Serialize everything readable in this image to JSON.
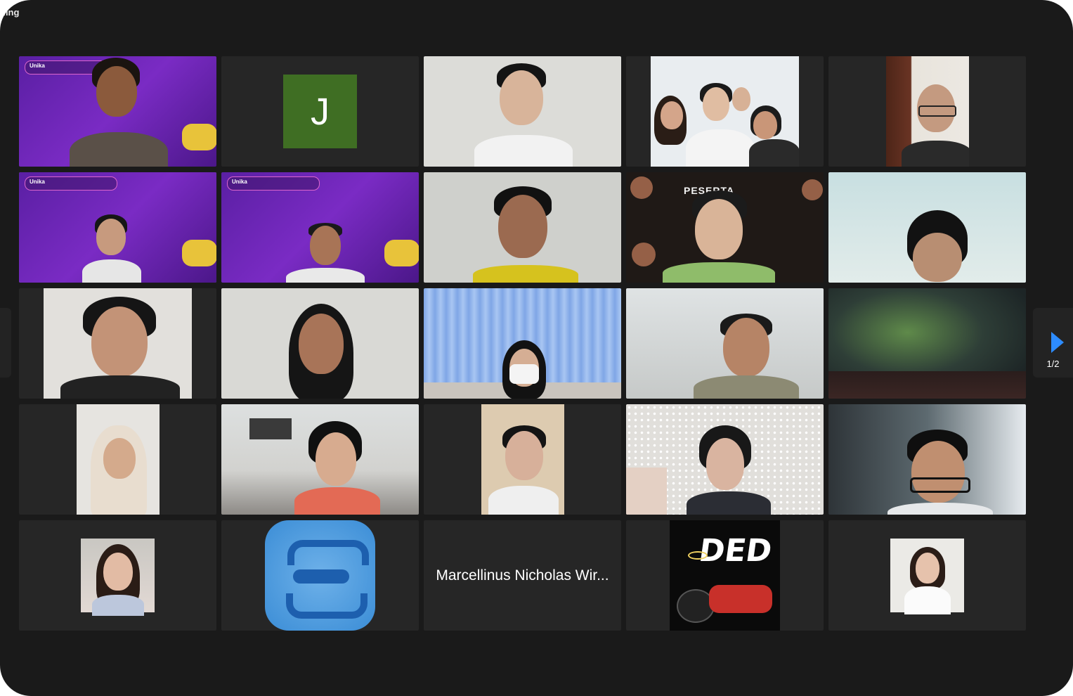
{
  "recording_label": "ding",
  "pager": {
    "count": "1/2"
  },
  "tiles": [
    {
      "kind": "video",
      "bg": "purple",
      "banner": "Unika"
    },
    {
      "kind": "initial",
      "initial": "J"
    },
    {
      "kind": "video",
      "bg": "light"
    },
    {
      "kind": "video",
      "bg": "room-group"
    },
    {
      "kind": "video",
      "bg": "door"
    },
    {
      "kind": "video",
      "bg": "purple",
      "banner": "Unika",
      "active": true
    },
    {
      "kind": "video",
      "bg": "purple",
      "banner": "Unika"
    },
    {
      "kind": "video",
      "bg": "light"
    },
    {
      "kind": "video",
      "bg": "dark-floral",
      "overlay_text": "PESERTA"
    },
    {
      "kind": "video",
      "bg": "pale-blue"
    },
    {
      "kind": "video",
      "bg": "grey"
    },
    {
      "kind": "video",
      "bg": "light"
    },
    {
      "kind": "video",
      "bg": "curtain"
    },
    {
      "kind": "video",
      "bg": "grey"
    },
    {
      "kind": "video",
      "bg": "aurora"
    },
    {
      "kind": "video",
      "bg": "white-room"
    },
    {
      "kind": "video",
      "bg": "bedroom"
    },
    {
      "kind": "video",
      "bg": "beige"
    },
    {
      "kind": "video",
      "bg": "pegboard"
    },
    {
      "kind": "video",
      "bg": "dim-room"
    },
    {
      "kind": "photo",
      "bg": "photo-girl"
    },
    {
      "kind": "logo",
      "bg": "blue-logo"
    },
    {
      "kind": "name",
      "name": "Marcellinus Nicholas Wir..."
    },
    {
      "kind": "sticker",
      "sticker_text": "DED"
    },
    {
      "kind": "photo",
      "bg": "photo-girl-white"
    }
  ]
}
